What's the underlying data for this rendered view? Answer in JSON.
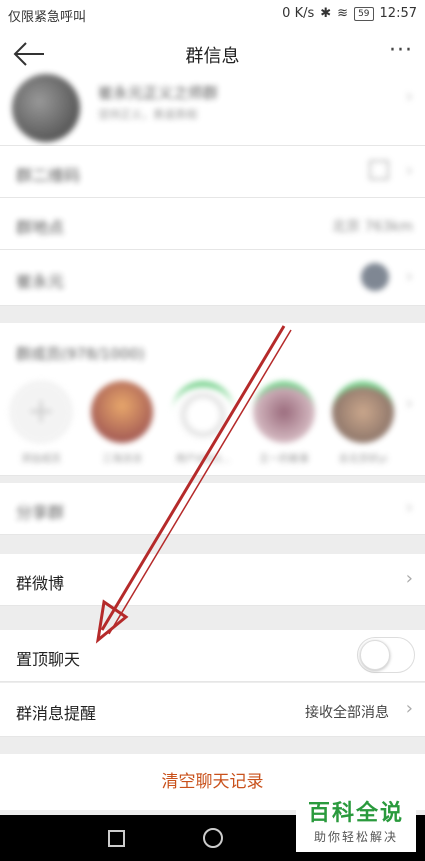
{
  "status_bar": {
    "left_text": "仅限紧急呼叫",
    "speed": "0 K/s",
    "battery": "59",
    "time": "12:57"
  },
  "nav": {
    "title": "群信息",
    "back_icon": "back-arrow-icon",
    "more_icon": "more-dots-icon",
    "more_glyph": "···"
  },
  "group_header": {
    "name": "崔永元正义之师群",
    "subtitle": "坚持正义，勇道真相"
  },
  "rows": {
    "qr_label": "群二维码",
    "location_label": "群地点",
    "location_value": "北京 763km",
    "owner_label": "崔永元",
    "members_label": "群成员(978/1000)",
    "share_label": "分享群",
    "weibo_label": "群微博",
    "pin_label": "置顶聊天",
    "notify_label": "群消息提醒",
    "notify_value": "接收全部消息",
    "clear_label": "清空聊天记录"
  },
  "members": [
    {
      "name": "添加成员"
    },
    {
      "name": "三海涂涂"
    },
    {
      "name": "用户9993..."
    },
    {
      "name": "王一的敢事"
    },
    {
      "name": "去北京好yi"
    }
  ],
  "toggle_pin": {
    "on": false
  },
  "watermark": {
    "main": "百科全说",
    "sub": "助你轻松解决"
  },
  "chevron": "›",
  "colors": {
    "accent_red": "#c9511b",
    "watermark_green": "#2a9a3d",
    "annotation_arrow": "#b52a2a"
  }
}
